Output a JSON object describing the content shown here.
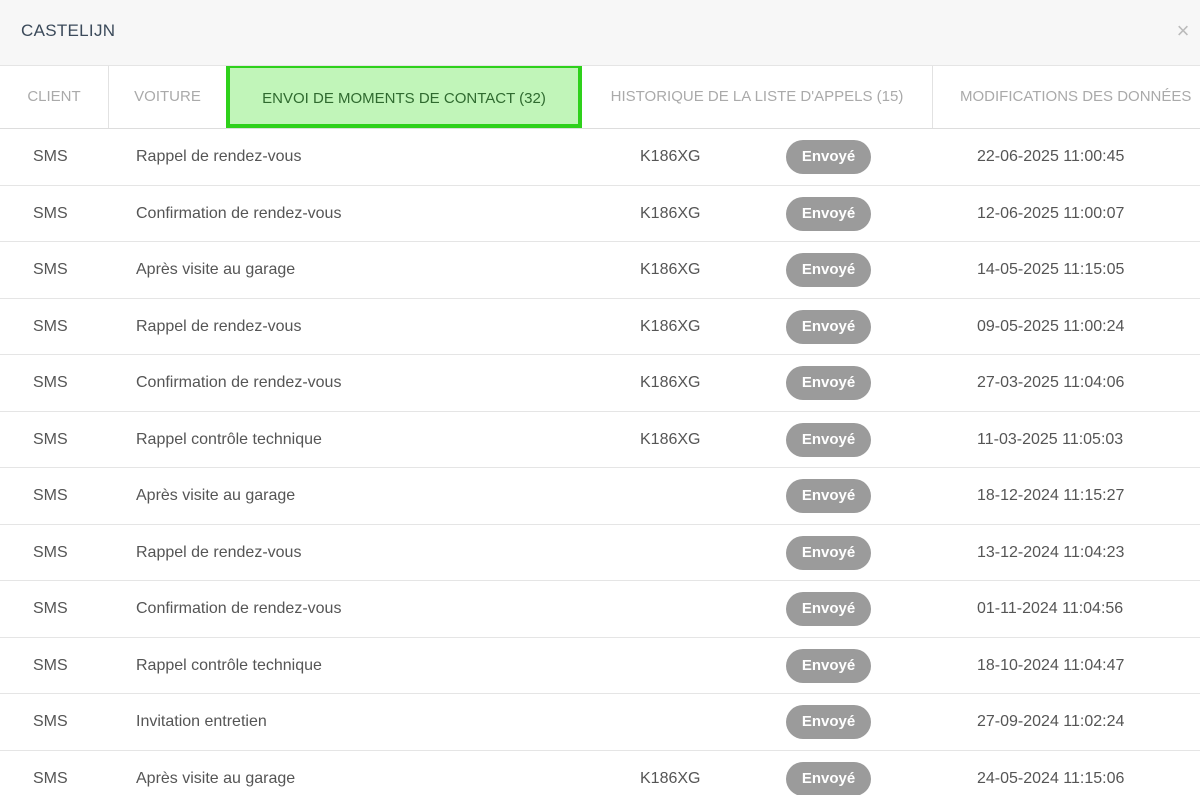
{
  "modal": {
    "title": "CASTELIJN",
    "close_label": "×"
  },
  "tabs": [
    {
      "label": "CLIENT",
      "active": false
    },
    {
      "label": "VOITURE",
      "active": false
    },
    {
      "label": "ENVOI DE MOMENTS DE CONTACT (32)",
      "active": true
    },
    {
      "label": "HISTORIQUE DE LA LISTE D'APPELS (15)",
      "active": false
    },
    {
      "label": "MODIFICATIONS DES DONNÉES",
      "active": false
    }
  ],
  "colors": {
    "active_tab_bg": "#c1f5b9",
    "active_tab_border": "#2ed11b",
    "badge_bg": "#9b9b9b"
  },
  "rows": [
    {
      "type": "SMS",
      "name": "Rappel de rendez-vous",
      "plate": "K186XG",
      "status": "Envoyé",
      "date": "22-06-2025 11:00:45"
    },
    {
      "type": "SMS",
      "name": "Confirmation de rendez-vous",
      "plate": "K186XG",
      "status": "Envoyé",
      "date": "12-06-2025 11:00:07"
    },
    {
      "type": "SMS",
      "name": "Après visite au garage",
      "plate": "K186XG",
      "status": "Envoyé",
      "date": "14-05-2025 11:15:05"
    },
    {
      "type": "SMS",
      "name": "Rappel de rendez-vous",
      "plate": "K186XG",
      "status": "Envoyé",
      "date": "09-05-2025 11:00:24"
    },
    {
      "type": "SMS",
      "name": "Confirmation de rendez-vous",
      "plate": "K186XG",
      "status": "Envoyé",
      "date": "27-03-2025 11:04:06"
    },
    {
      "type": "SMS",
      "name": "Rappel contrôle technique",
      "plate": "K186XG",
      "status": "Envoyé",
      "date": "11-03-2025 11:05:03"
    },
    {
      "type": "SMS",
      "name": "Après visite au garage",
      "plate": "",
      "status": "Envoyé",
      "date": "18-12-2024 11:15:27"
    },
    {
      "type": "SMS",
      "name": "Rappel de rendez-vous",
      "plate": "",
      "status": "Envoyé",
      "date": "13-12-2024 11:04:23"
    },
    {
      "type": "SMS",
      "name": "Confirmation de rendez-vous",
      "plate": "",
      "status": "Envoyé",
      "date": "01-11-2024 11:04:56"
    },
    {
      "type": "SMS",
      "name": "Rappel contrôle technique",
      "plate": "",
      "status": "Envoyé",
      "date": "18-10-2024 11:04:47"
    },
    {
      "type": "SMS",
      "name": "Invitation entretien",
      "plate": "",
      "status": "Envoyé",
      "date": "27-09-2024 11:02:24"
    },
    {
      "type": "SMS",
      "name": "Après visite au garage",
      "plate": "K186XG",
      "status": "Envoyé",
      "date": "24-05-2024 11:15:06"
    }
  ]
}
